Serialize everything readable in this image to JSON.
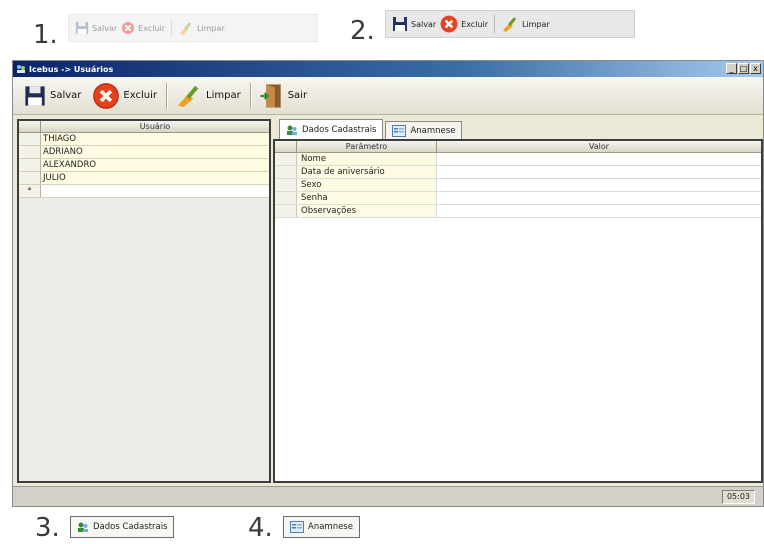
{
  "steps": {
    "one": "1.",
    "two": "2.",
    "three": "3.",
    "four": "4."
  },
  "strip_buttons": {
    "save": "Salvar",
    "delete": "Excluir",
    "clear": "Limpar"
  },
  "window": {
    "title": "Icebus -> Usuários",
    "controls": {
      "minimize": "_",
      "maximize": "□",
      "close": "x"
    }
  },
  "toolbar": {
    "save": "Salvar",
    "delete": "Excluir",
    "clear": "Limpar",
    "exit": "Sair"
  },
  "users_grid": {
    "column": "Usuário",
    "rows": [
      "THIAGO",
      "ADRIANO",
      "ALEXANDRO",
      "JULIO"
    ],
    "new_row_marker": "*"
  },
  "tabs": {
    "personal": "Dados Cadastrais",
    "anamnesis": "Anamnese"
  },
  "params_grid": {
    "col_param": "Parâmetro",
    "col_value": "Valor",
    "rows": [
      "Nome",
      "Data de aniversário",
      "Sexo",
      "Senha",
      "Observações"
    ]
  },
  "status": {
    "clock": "05:03"
  },
  "colors": {
    "title_start": "#0a246a",
    "title_end": "#a6caf0",
    "row_highlight": "#fffbe3",
    "chrome": "#ece9d8"
  },
  "icons": {
    "save": "floppy-disk-icon",
    "delete": "red-x-icon",
    "clear": "broom-icon",
    "exit": "door-exit-icon",
    "personal_tab": "users-icon",
    "anamnesis_tab": "form-icon"
  }
}
